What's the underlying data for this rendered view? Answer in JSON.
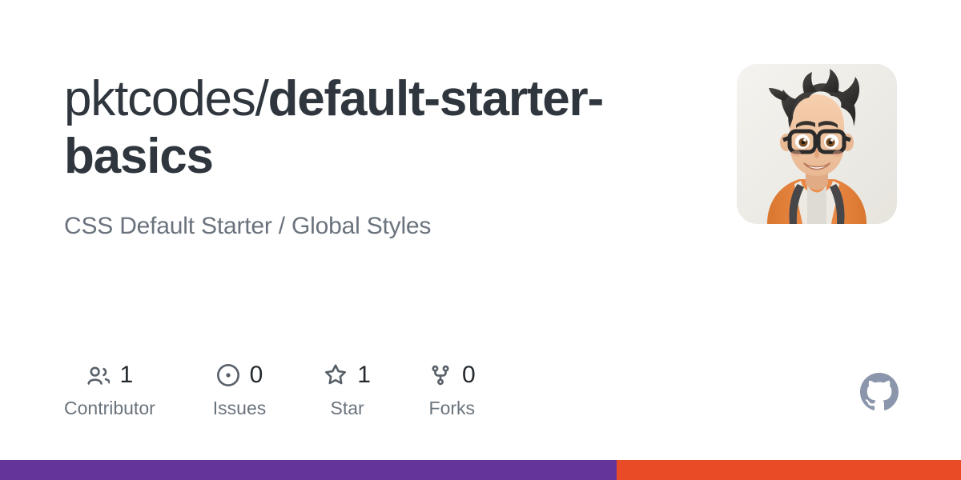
{
  "repository": {
    "owner": "pktcodes",
    "separator": "/",
    "name": "default-starter-basics",
    "description": "CSS Default Starter / Global Styles"
  },
  "avatar": {
    "icon": "user-avatar-illustration",
    "background_color": "#efeee9",
    "hair_color": "#3b3a38",
    "skin_color": "#f0c5a4",
    "glasses_color": "#2b2b2b",
    "hoodie_color": "#e8873f"
  },
  "stats": [
    {
      "icon": "people-icon",
      "value": "1",
      "label": "Contributor"
    },
    {
      "icon": "issue-opened-icon",
      "value": "0",
      "label": "Issues"
    },
    {
      "icon": "star-icon",
      "value": "1",
      "label": "Star"
    },
    {
      "icon": "repo-forked-icon",
      "value": "0",
      "label": "Forks"
    }
  ],
  "branding": {
    "mark": "github-mark-icon",
    "mark_color": "#8b95ab"
  },
  "bottom_bar": {
    "primary_color": "#65349a",
    "secondary_color": "#e84b25"
  },
  "colors": {
    "title": "#2f363d",
    "description": "#6a737d",
    "stat_value": "#24292e",
    "stat_label": "#6a737d",
    "icon": "#586069",
    "background": "#ffffff"
  }
}
